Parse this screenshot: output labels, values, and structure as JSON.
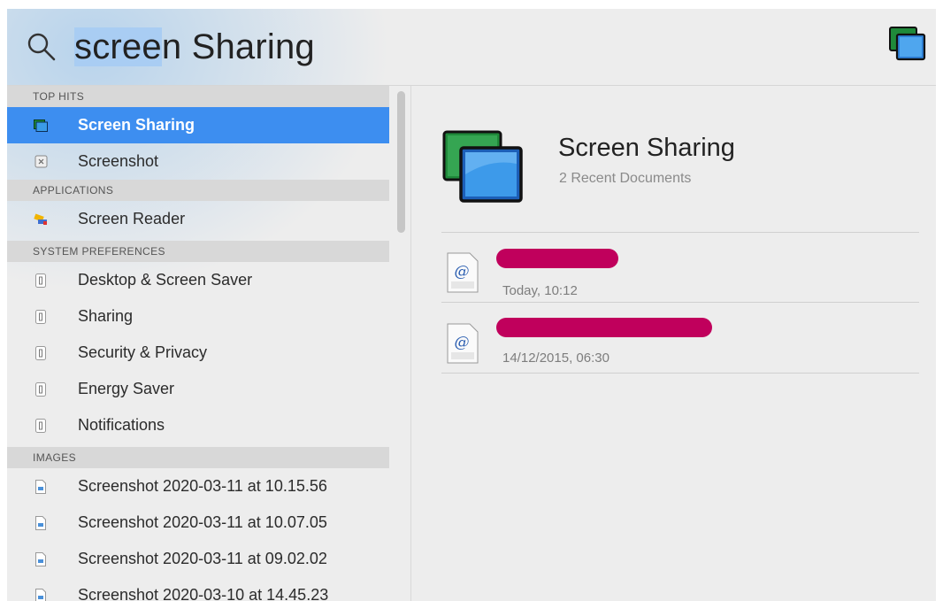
{
  "search": {
    "query_selected": "scree",
    "query_rest": "n Sharing"
  },
  "sections": {
    "top_hits": "TOP HITS",
    "applications": "APPLICATIONS",
    "system_preferences": "SYSTEM PREFERENCES",
    "images": "IMAGES"
  },
  "top_hits": [
    {
      "label": "Screen Sharing",
      "icon": "screen-sharing-icon"
    },
    {
      "label": "Screenshot",
      "icon": "screenshot-app-icon"
    }
  ],
  "applications": [
    {
      "label": "Screen Reader",
      "icon": "screen-reader-icon"
    }
  ],
  "system_preferences": [
    {
      "label": "Desktop & Screen Saver",
      "icon": "preference-pane-icon"
    },
    {
      "label": "Sharing",
      "icon": "preference-pane-icon"
    },
    {
      "label": "Security & Privacy",
      "icon": "preference-pane-icon"
    },
    {
      "label": "Energy Saver",
      "icon": "preference-pane-icon"
    },
    {
      "label": "Notifications",
      "icon": "preference-pane-icon"
    }
  ],
  "images": [
    {
      "label": "Screenshot 2020-03-11 at 10.15.56",
      "icon": "image-file-icon"
    },
    {
      "label": "Screenshot 2020-03-11 at 10.07.05",
      "icon": "image-file-icon"
    },
    {
      "label": "Screenshot 2020-03-11 at 09.02.02",
      "icon": "image-file-icon"
    },
    {
      "label": "Screenshot 2020-03-10 at 14.45.23",
      "icon": "image-file-icon"
    }
  ],
  "preview": {
    "title": "Screen Sharing",
    "subtitle": "2 Recent Documents",
    "documents": [
      {
        "date": "Today, 10:12",
        "icon": "vnc-file-icon",
        "name_redacted": true
      },
      {
        "date": "14/12/2015, 06:30",
        "icon": "vnc-file-icon",
        "name_redacted": true
      }
    ]
  },
  "colors": {
    "selection": "#3d8ef0",
    "query_highlight": "#a9cdf3",
    "redaction": "#c0005c"
  }
}
